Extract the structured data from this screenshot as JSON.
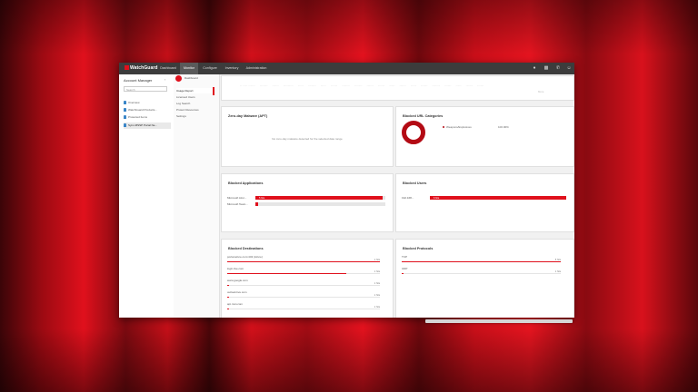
{
  "app": {
    "logo_text": "WatchGuard",
    "brand_color": "#e0101c"
  },
  "nav_tabs": [
    {
      "label": "Dashboard",
      "active": false
    },
    {
      "label": "Monitor",
      "active": true
    },
    {
      "label": "Configure",
      "active": false
    },
    {
      "label": "Inventory",
      "active": false
    },
    {
      "label": "Administration",
      "active": false
    }
  ],
  "top_icons": [
    "bell-icon",
    "briefcase-icon",
    "phone-icon",
    "user-icon"
  ],
  "left_panel": {
    "title": "Account Manager",
    "search_placeholder": "Search",
    "items": [
      {
        "label": "Overview",
        "selected": false
      },
      {
        "label": "WatchGuard Products...",
        "selected": false
      },
      {
        "label": "Protected Items",
        "selected": false
      },
      {
        "label": "Sync-MSSP Portal Ne...",
        "selected": true
      }
    ]
  },
  "subnav": {
    "header": "Dashboard",
    "items": [
      {
        "label": "Usage Report",
        "active": true
      },
      {
        "label": "Licensed Users",
        "active": false
      },
      {
        "label": "Log Search",
        "active": false
      },
      {
        "label": "Protect Resources",
        "active": false
      },
      {
        "label": "Settings",
        "active": false
      }
    ]
  },
  "top_strip": {
    "labels": [
      "-- ---- ------",
      "-------",
      "------",
      "---------",
      "-----",
      "-------",
      "-----",
      "------",
      "-------",
      "-------",
      "------",
      "------",
      "-----",
      "------",
      "-----",
      "------",
      "-------",
      "------",
      "-----",
      "------",
      "------"
    ],
    "more": "More"
  },
  "cards": {
    "zero_day": {
      "title": "Zero-day Malware (APT)",
      "message": "No zero-day malware detected for the selected date range"
    },
    "url_categories": {
      "title": "Blocked URL Categories",
      "legend_label": "Weapons/Explosives",
      "legend_value": "100.00%"
    },
    "applications": {
      "title": "Blocked Applications",
      "rows": [
        {
          "label": "Microsoft Azur...",
          "value_text": "5 hits",
          "fraction": 0.98
        },
        {
          "label": "Microsoft Team...",
          "value_text": "",
          "fraction": 0.02
        }
      ]
    },
    "users": {
      "title": "Blocked Users",
      "rows": [
        {
          "label": "192.168...",
          "value_text": "6 hits",
          "fraction": 1.0
        }
      ]
    },
    "destinations": {
      "title": "Blocked Destinations",
      "rows": [
        {
          "label": "portal.azure.com:443 (Azure)",
          "value_text": "1 hits",
          "fraction": 1.0
        },
        {
          "label": "login.live.com",
          "value_text": "1 hits",
          "fraction": 0.78
        },
        {
          "label": "www.google.com",
          "value_text": "1 hits",
          "fraction": 0.01
        },
        {
          "label": "outlook.live.com",
          "value_text": "1 hits",
          "fraction": 0.01
        },
        {
          "label": "api.msn.com",
          "value_text": "1 hits",
          "fraction": 0.01
        }
      ]
    },
    "protocols": {
      "title": "Blocked Protocols",
      "rows": [
        {
          "label": "TCP",
          "value_text": "5 hits",
          "fraction": 1.0
        },
        {
          "label": "UDP",
          "value_text": "1 hits",
          "fraction": 0.01
        }
      ]
    }
  }
}
